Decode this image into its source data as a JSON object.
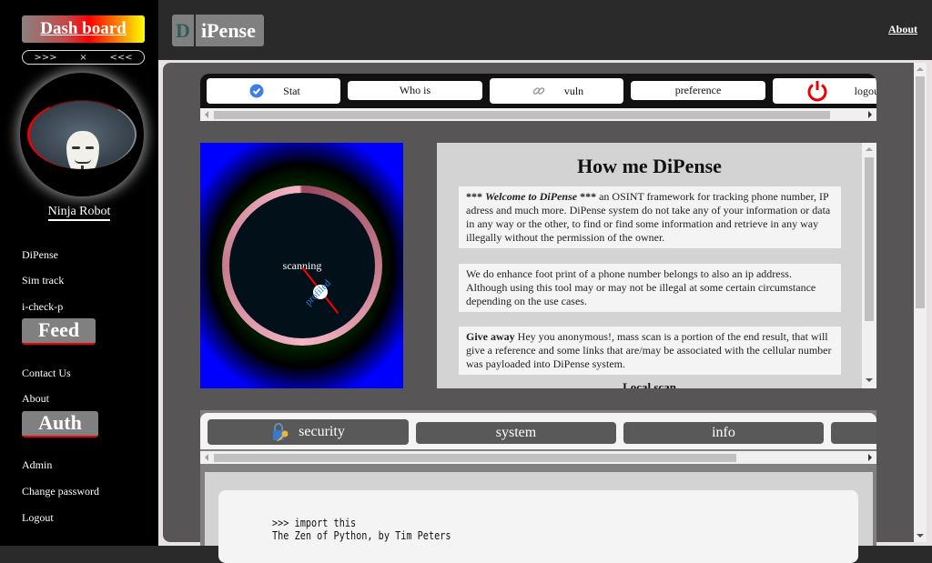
{
  "sidebar": {
    "dashboard_label": "Dash board",
    "toggle": {
      "left": ">>>",
      "close": "×",
      "right": "<<<"
    },
    "avatar_icon": "anonymous-mask-avatar",
    "user_name": "Ninja Robot",
    "links_group1": [
      "DiPense",
      "Sim track",
      "i-check-p"
    ],
    "feed_label": "Feed",
    "links_group2": [
      "Contact Us",
      "About"
    ],
    "auth_label": "Auth",
    "links_group3": [
      "Admin",
      "Change password",
      "Logout"
    ]
  },
  "header": {
    "brand_initial": "D",
    "brand_rest": "iPense",
    "about_link": "About"
  },
  "top_tabs": [
    {
      "label": "Stat",
      "icon": "check-circle-icon"
    },
    {
      "label": "Who is",
      "icon": ""
    },
    {
      "label": "vuln",
      "icon": "link-icon"
    },
    {
      "label": "preference",
      "icon": ""
    },
    {
      "label": "logout",
      "icon": "power-icon"
    }
  ],
  "gauge": {
    "center_label": "scanning",
    "hub_label": "profiled",
    "colors": {
      "needle": "#ff0000",
      "ring_light": "#f4b5c5",
      "ring_dark": "#9a4a60"
    }
  },
  "info": {
    "title": "How me DiPense",
    "card1": {
      "lead": "*** ",
      "lead_italic": "Welcome to DiPense",
      "lead_end": " ***",
      "text": " an OSINT framework for tracking phone number, IP adress and much more. DiPense system do not take any of your information or data in any way or the other, to find or find some information and retrieve in any way illegally without the permission of the owner."
    },
    "card2": {
      "text": "We do enhance foot print of a phone number belongs to also an ip address. Although using this tool may or may not be illegal at some certain circumstance depending on the use cases."
    },
    "card3": {
      "lead": "Give away",
      "text": " Hey you anonymous!, mass scan is a portion of the end result, that will give a reference and some links that are/may be associated with the cellular number was payloaded into DiPense system."
    },
    "subheading": "Local scan"
  },
  "bottom_tabs": [
    {
      "label": "security",
      "icon": "lock-key-icon"
    },
    {
      "label": "system"
    },
    {
      "label": "info"
    },
    {
      "label": ""
    }
  ],
  "code": {
    "line1": ">>> import this",
    "line2": "The Zen of Python, by Tim Peters"
  }
}
